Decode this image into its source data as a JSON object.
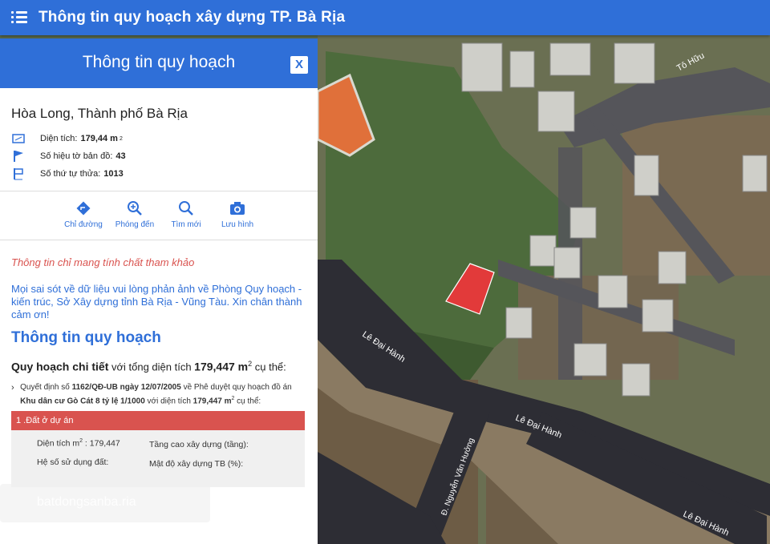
{
  "header": {
    "title": "Thông tin quy hoạch xây dựng TP. Bà Rịa"
  },
  "panel": {
    "title": "Thông tin quy hoạch",
    "close_label": "X",
    "location": "Hòa Long, Thành phố Bà Rịa",
    "area_label": "Diện tích:",
    "area_value": "179,44 m",
    "area_sup": "2",
    "sheet_label": "Số hiệu tờ bản đồ:",
    "sheet_value": "43",
    "plot_label": "Số thứ tự thửa:",
    "plot_value": "1013",
    "actions": [
      {
        "label": "Chỉ đường",
        "icon": "directions-icon"
      },
      {
        "label": "Phóng đến",
        "icon": "zoom-in-icon"
      },
      {
        "label": "Tìm mới",
        "icon": "search-icon"
      },
      {
        "label": "Lưu hình",
        "icon": "camera-icon"
      }
    ],
    "warning": "Thông tin chỉ mang tính chất tham khảo",
    "report": "Mọi sai sót về dữ liệu vui lòng phản ảnh về Phòng Quy hoạch - kiến trúc, Sở Xây dựng tỉnh Bà Rịa - Vũng Tàu. Xin chân thành cảm ơn!",
    "section_title": "Thông tin quy hoạch",
    "detail_prefix": "Quy hoạch chi tiết",
    "detail_mid": " với tổng diện tích ",
    "detail_value": "179,447 m",
    "detail_sup": "2",
    "detail_suffix": " cụ thể:",
    "decision_a": "Quyết định số ",
    "decision_b": "1162/QĐ-UB ngày 12/07/2005",
    "decision_c": " về Phê duyệt quy hoạch đồ án ",
    "decision_d": "Khu dân cư Gò Cát 8 tỷ lệ 1/1000",
    "decision_e": " với diện tích ",
    "decision_f": "179,447 m",
    "decision_sup": "2",
    "decision_g": " cụ thể:",
    "land_use": {
      "label": "1 .Đất ở dự án",
      "area_label": "Diện tích m",
      "area_sup": "2",
      "area_value": " : 179,447",
      "floors_label": "Tầng cao xây dựng (tầng):",
      "far_label": "Hệ số sử dụng đất:",
      "density_label": "Mật độ xây dựng TB (%):"
    },
    "watermark": "batdongsanba.ria"
  },
  "map": {
    "streets": [
      "Tô Hữu",
      "Lê Đại Hành",
      "Lê Đại Hành",
      "Lê Đại Hành",
      "Đ. Nguyễn Văn Hưởng"
    ],
    "parcel_color": "#e23a3a"
  }
}
